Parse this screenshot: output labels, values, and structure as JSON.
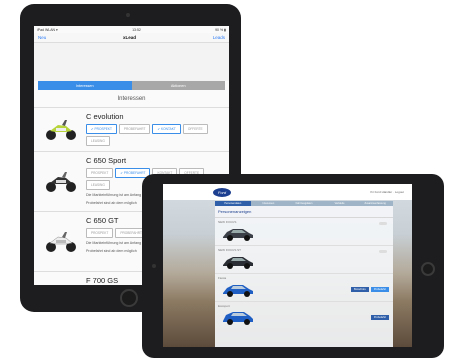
{
  "tablet1": {
    "status": {
      "carrier": "iPad WLAN ▾",
      "time": "13:52",
      "battery": "90 % ▮"
    },
    "nav": {
      "left": "Neu",
      "title": "xLead",
      "right": "Leads"
    },
    "segment": {
      "left": "Interessen",
      "right": "Aktionen"
    },
    "section": "Interessen",
    "products": [
      {
        "name": "C evolution",
        "tags": [
          {
            "label": "✔ PROSPEKT",
            "on": true
          },
          {
            "label": "PROBEFAHRT",
            "on": false
          },
          {
            "label": "✔ KONTAKT",
            "on": true
          },
          {
            "label": "OFFERTE",
            "on": false
          },
          {
            "label": "LEASING",
            "on": false
          }
        ],
        "note": [
          "",
          ""
        ]
      },
      {
        "name": "C 650 Sport",
        "tags": [
          {
            "label": "PROSPEKT",
            "on": false
          },
          {
            "label": "✔ PROBEFAHRT",
            "on": true
          },
          {
            "label": "KONTAKT",
            "on": false
          },
          {
            "label": "OFFERTE",
            "on": false
          },
          {
            "label": "LEASING",
            "on": false
          }
        ],
        "note": [
          "Die Markteinführung ist am Anfang",
          "Probefahrt sind ab dem möglich"
        ]
      },
      {
        "name": "C 650 GT",
        "tags": [
          {
            "label": "PROSPEKT",
            "on": false
          },
          {
            "label": "PROBEFAHRT",
            "on": false
          },
          {
            "label": "KONTAKT",
            "on": false
          },
          {
            "label": "OFFERTE",
            "on": false
          },
          {
            "label": "LEASING",
            "on": false
          }
        ],
        "note": [
          "Die Markteinführung ist am Anfang",
          "Probefahrt sind ab dem möglich"
        ]
      },
      {
        "name": "F 700 GS",
        "tags": [],
        "note": [
          "",
          ""
        ]
      }
    ]
  },
  "tablet2": {
    "brand": "Ford",
    "header_right": "Ihr Ford Händler · Logout",
    "tabs": [
      "Personendaten",
      "Interessen",
      "Fahrzeugdaten",
      "Verkäufe",
      "Zusammenfassung"
    ],
    "section_title": "Personenanzeigen",
    "rows": [
      {
        "label": "NEW FOCUS",
        "buttons": []
      },
      {
        "label": "NEW FOCUS ST",
        "buttons": []
      },
      {
        "label": "Fiesta",
        "buttons": [
          "Broschüre",
          "Probefahrt"
        ]
      },
      {
        "label": "Ecosport",
        "buttons": [
          "Probefahrt"
        ]
      }
    ],
    "colors": {
      "ford_blue": "#1d3f8f",
      "accent": "#2f5fa8"
    }
  }
}
